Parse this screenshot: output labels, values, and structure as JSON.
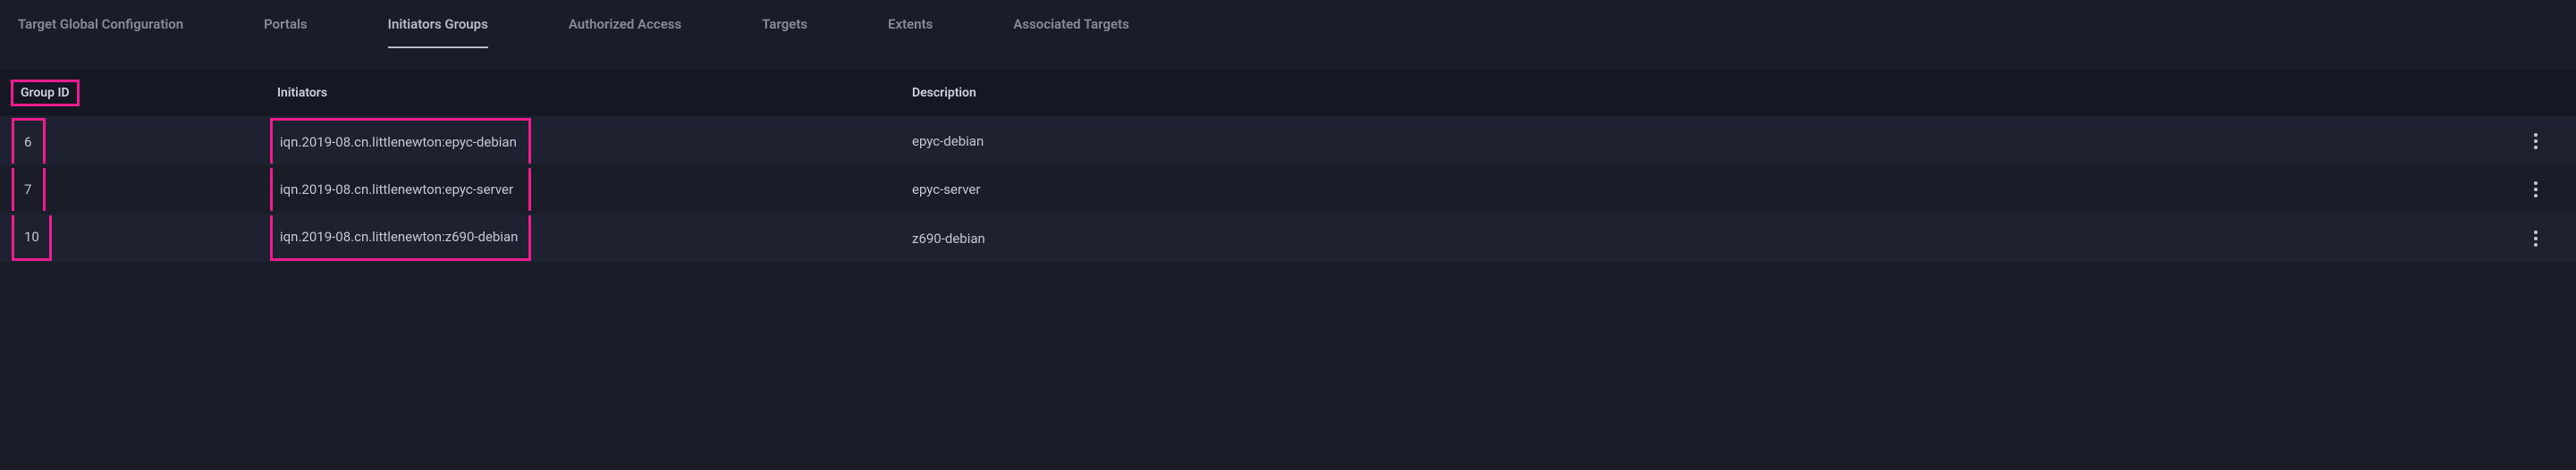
{
  "tabs": [
    {
      "label": "Target Global Configuration",
      "active": false
    },
    {
      "label": "Portals",
      "active": false
    },
    {
      "label": "Initiators Groups",
      "active": true
    },
    {
      "label": "Authorized Access",
      "active": false
    },
    {
      "label": "Targets",
      "active": false
    },
    {
      "label": "Extents",
      "active": false
    },
    {
      "label": "Associated Targets",
      "active": false
    }
  ],
  "columns": {
    "group_id": "Group ID",
    "initiators": "Initiators",
    "description": "Description"
  },
  "rows": [
    {
      "group_id": "6",
      "initiators": "iqn.2019-08.cn.littlenewton:epyc-debian",
      "description": "epyc-debian"
    },
    {
      "group_id": "7",
      "initiators": "iqn.2019-08.cn.littlenewton:epyc-server",
      "description": "epyc-server"
    },
    {
      "group_id": "10",
      "initiators": "iqn.2019-08.cn.littlenewton:z690-debian",
      "description": "z690-debian"
    }
  ]
}
